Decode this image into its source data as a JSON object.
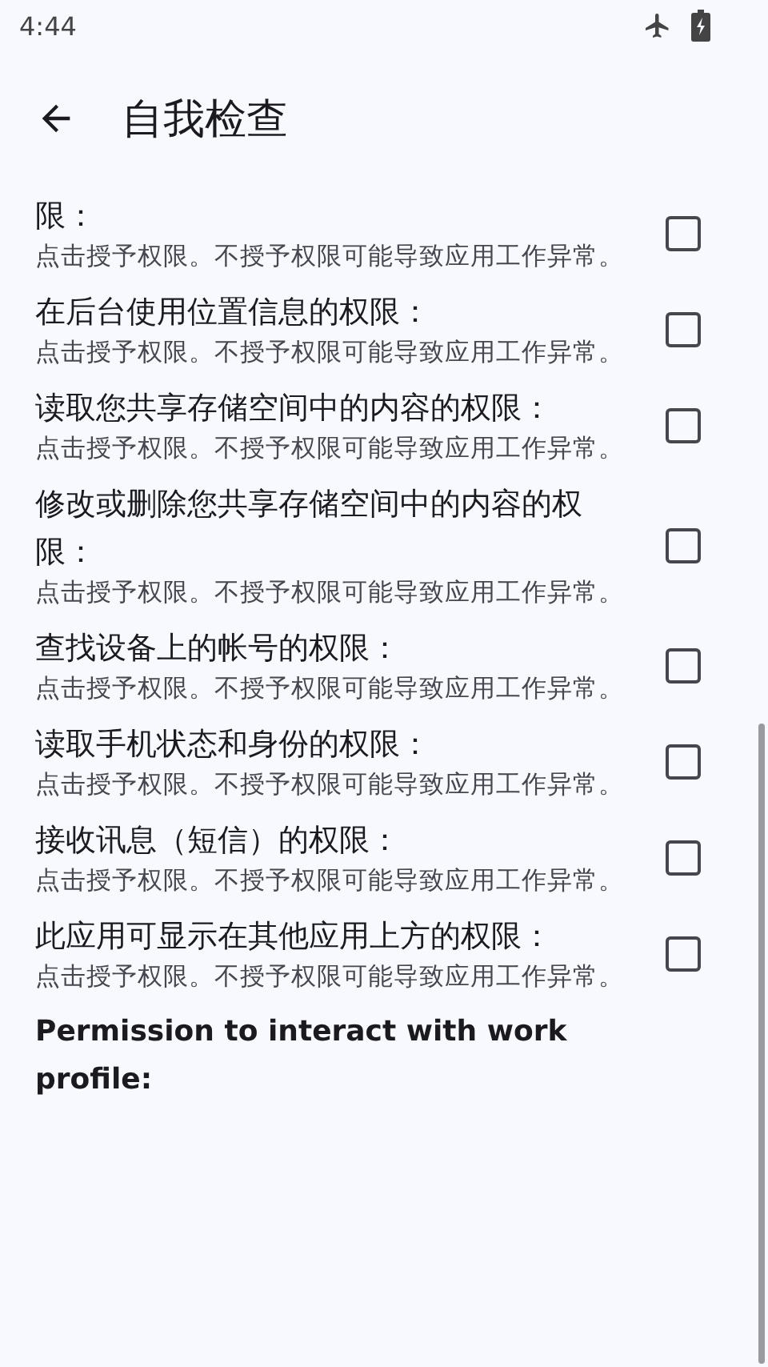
{
  "status_bar": {
    "time": "4:44"
  },
  "app_bar": {
    "title": "自我检查"
  },
  "items": [
    {
      "kind": "permission",
      "title": "限：",
      "description": "点击授予权限。不授予权限可能导致应用工作异常。",
      "checked": false
    },
    {
      "kind": "permission",
      "title": "在后台使用位置信息的权限：",
      "description": "点击授予权限。不授予权限可能导致应用工作异常。",
      "checked": false
    },
    {
      "kind": "permission",
      "title": "读取您共享存储空间中的内容的权限：",
      "description": "点击授予权限。不授予权限可能导致应用工作异常。",
      "checked": false
    },
    {
      "kind": "permission",
      "title": "修改或删除您共享存储空间中的内容的权限：",
      "description": "点击授予权限。不授予权限可能导致应用工作异常。",
      "checked": false
    },
    {
      "kind": "permission",
      "title": "查找设备上的帐号的权限：",
      "description": "点击授予权限。不授予权限可能导致应用工作异常。",
      "checked": false
    },
    {
      "kind": "permission",
      "title": "读取手机状态和身份的权限：",
      "description": "点击授予权限。不授予权限可能导致应用工作异常。",
      "checked": false
    },
    {
      "kind": "permission",
      "title": "接收讯息（短信）的权限：",
      "description": "点击授予权限。不授予权限可能导致应用工作异常。",
      "checked": false
    },
    {
      "kind": "permission",
      "title": "此应用可显示在其他应用上方的权限：",
      "description": "点击授予权限。不授予权限可能导致应用工作异常。",
      "checked": false
    },
    {
      "kind": "heading",
      "title": "Permission to interact with work profile:"
    }
  ]
}
